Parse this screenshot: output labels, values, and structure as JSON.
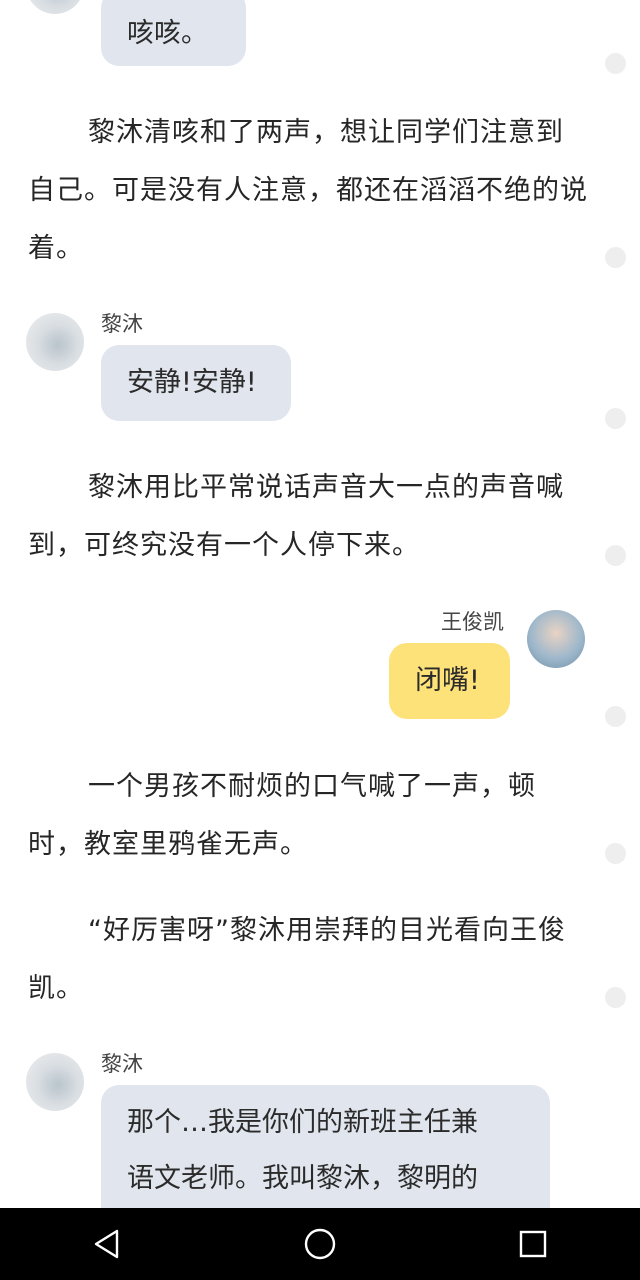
{
  "chat": {
    "speaker_limu": "黎沐",
    "speaker_wjk": "王俊凯",
    "bubble_cough": "咳咳。",
    "bubble_quiet": "安静!安静!",
    "bubble_shutup": "闭嘴!",
    "bubble_intro_line1": "那个…我是你们的新班主任兼",
    "bubble_intro_line2": "语文老师。我叫黎沐，黎明的"
  },
  "narration": {
    "p1": "黎沐清咳和了两声，想让同学们注意到自己。可是没有人注意，都还在滔滔不绝的说着。",
    "p2": "黎沐用比平常说话声音大一点的声音喊到，可终究没有一个人停下来。",
    "p3": "一个男孩不耐烦的口气喊了一声，顿时，教室里鸦雀无声。",
    "p4": "“好厉害呀”黎沐用崇拜的目光看向王俊凯。"
  },
  "navbar": {
    "back_icon": "back-triangle-icon",
    "home_icon": "home-circle-icon",
    "recents_icon": "recents-square-icon"
  }
}
